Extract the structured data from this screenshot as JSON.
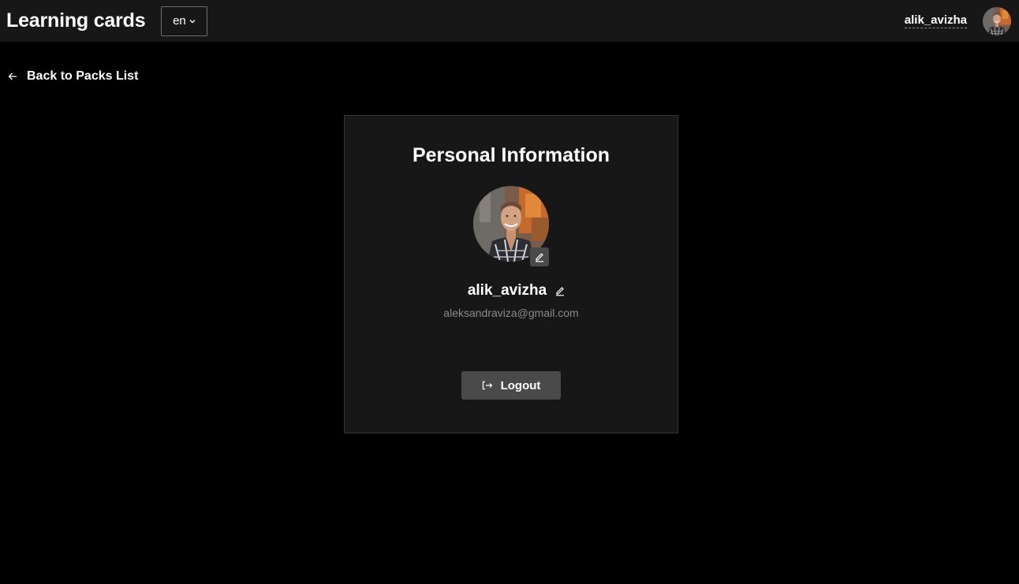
{
  "header": {
    "app_title": "Learning cards",
    "language": "en",
    "username": "alik_avizha"
  },
  "nav": {
    "back_label": "Back to Packs List"
  },
  "profile": {
    "title": "Personal Information",
    "name": "alik_avizha",
    "email": "aleksandraviza@gmail.com",
    "logout_label": "Logout"
  },
  "colors": {
    "background": "#000000",
    "header_bg": "#171717",
    "card_bg": "#171717",
    "button_bg": "#4a4a4a",
    "muted_text": "#8b8b8b"
  },
  "icons": {
    "language_dropdown": "chevron-down-icon",
    "back": "arrow-left-icon",
    "avatar_edit": "pencil-icon",
    "name_edit": "pencil-icon",
    "logout": "logout-icon"
  }
}
